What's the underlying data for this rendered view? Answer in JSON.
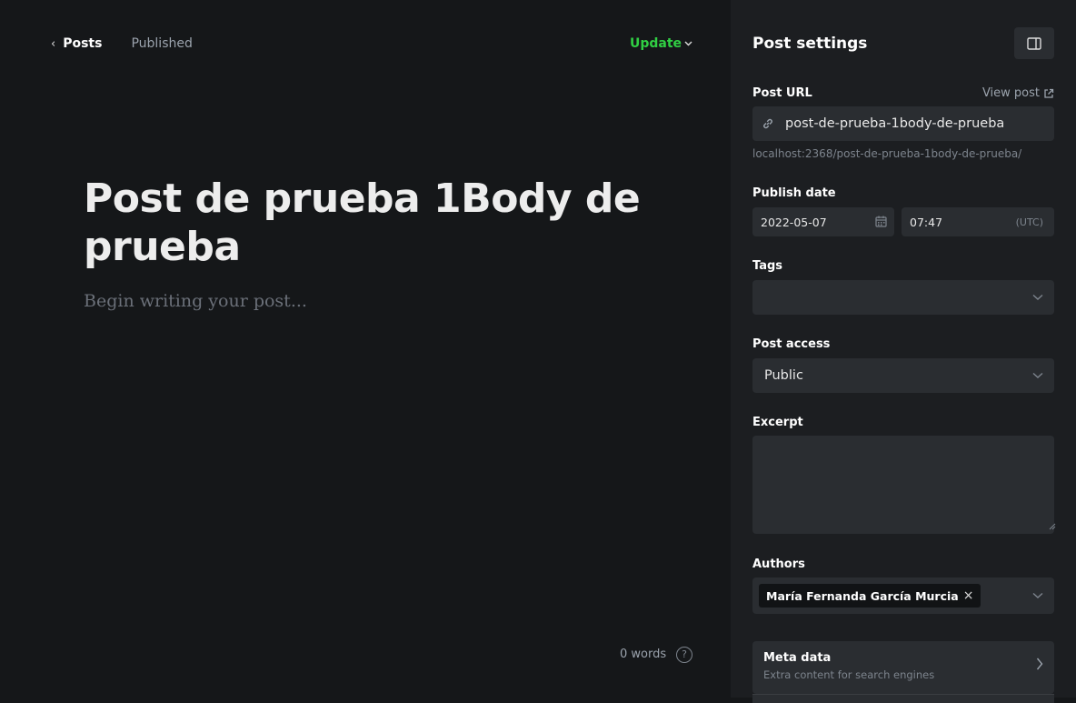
{
  "editor": {
    "back_label": "Posts",
    "status": "Published",
    "update_label": "Update",
    "title": "Post de prueba 1Body de prueba",
    "body_placeholder": "Begin writing your post...",
    "word_count": "0 words",
    "help_symbol": "?"
  },
  "sidebar": {
    "title": "Post settings",
    "post_url": {
      "label": "Post URL",
      "view_post": "View post",
      "value": "post-de-prueba-1body-de-prueba",
      "hint": "localhost:2368/post-de-prueba-1body-de-prueba/"
    },
    "publish_date": {
      "label": "Publish date",
      "date": "2022-05-07",
      "time": "07:47",
      "timezone": "(UTC)"
    },
    "tags": {
      "label": "Tags",
      "value": ""
    },
    "post_access": {
      "label": "Post access",
      "value": "Public"
    },
    "excerpt": {
      "label": "Excerpt",
      "value": ""
    },
    "authors": {
      "label": "Authors",
      "items": [
        "María Fernanda García Murcia"
      ]
    },
    "meta_data": {
      "title": "Meta data",
      "subtitle": "Extra content for search engines"
    }
  },
  "colors": {
    "accent_green": "#30cf43",
    "editor_bg": "#151719",
    "sidebar_bg": "#1c1e21",
    "input_bg": "#2a2d31"
  }
}
